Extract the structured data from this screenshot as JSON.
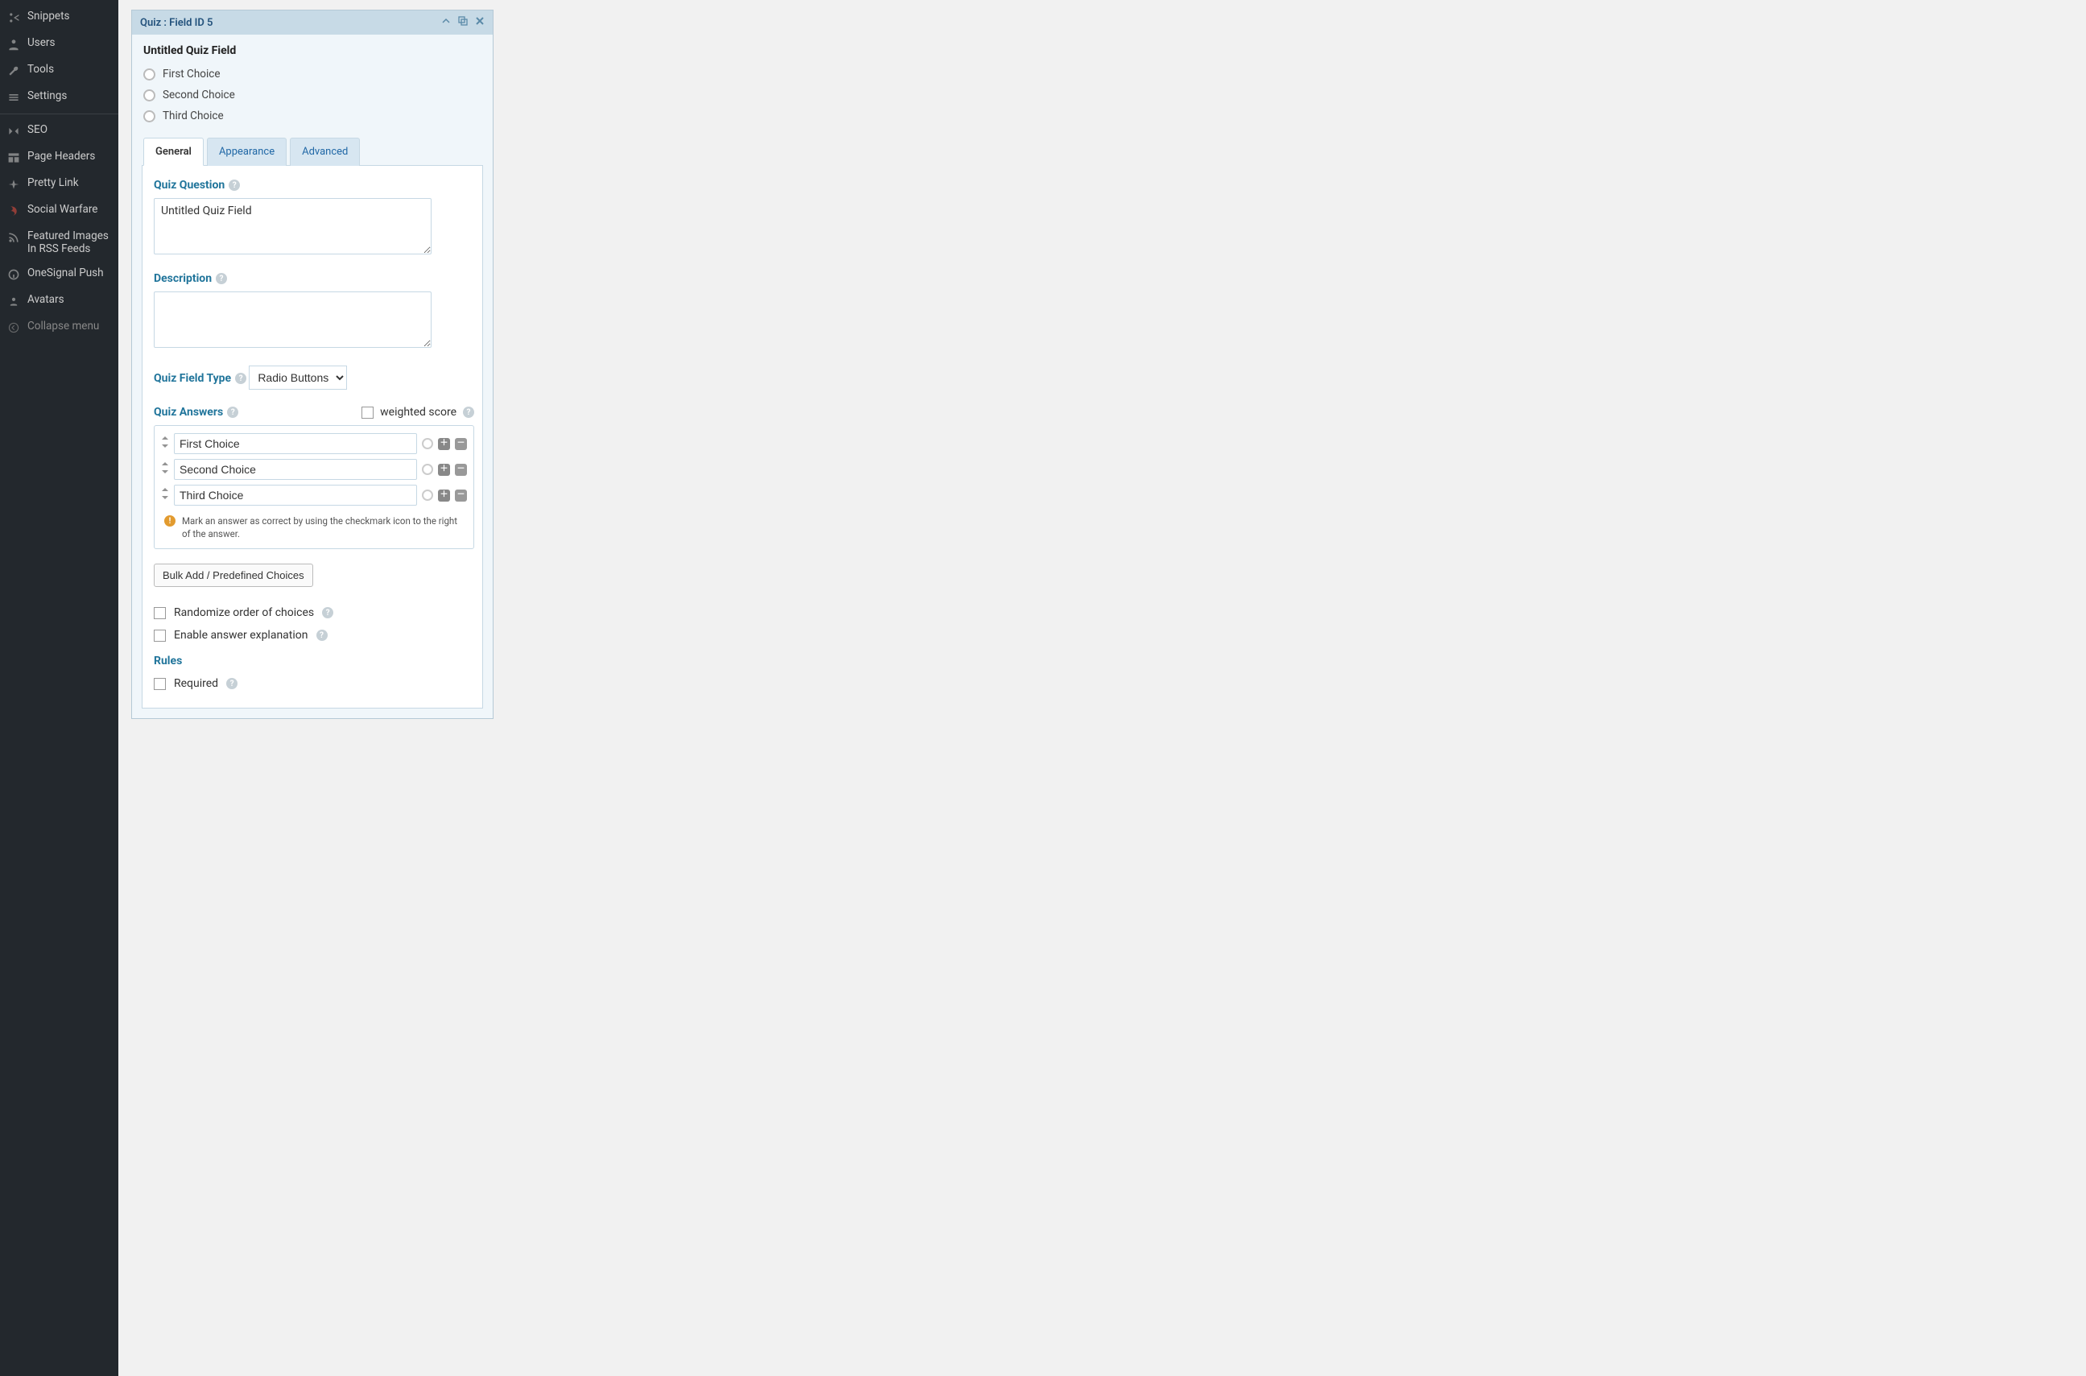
{
  "sidebar": {
    "items": [
      {
        "label": "Snippets"
      },
      {
        "label": "Users"
      },
      {
        "label": "Tools"
      },
      {
        "label": "Settings"
      }
    ],
    "items2": [
      {
        "label": "SEO"
      },
      {
        "label": "Page Headers"
      },
      {
        "label": "Pretty Link"
      },
      {
        "label": "Social Warfare"
      },
      {
        "label": "Featured Images In RSS Feeds"
      },
      {
        "label": "OneSignal Push"
      },
      {
        "label": "Avatars"
      }
    ],
    "collapse": "Collapse menu"
  },
  "panel": {
    "header": "Quiz : Field ID 5",
    "title": "Untitled Quiz Field",
    "choices": [
      "First Choice",
      "Second Choice",
      "Third Choice"
    ]
  },
  "tabs": {
    "general": "General",
    "appearance": "Appearance",
    "advanced": "Advanced"
  },
  "form": {
    "quizQuestionLabel": "Quiz Question",
    "quizQuestionValue": "Untitled Quiz Field",
    "descriptionLabel": "Description",
    "descriptionValue": "",
    "fieldTypeLabel": "Quiz Field Type",
    "fieldTypeValue": "Radio Buttons",
    "answersLabel": "Quiz Answers",
    "weightedLabel": "weighted score",
    "answers": [
      "First Choice",
      "Second Choice",
      "Third Choice"
    ],
    "hint": "Mark an answer as correct by using the checkmark icon to the right of the answer.",
    "bulkAdd": "Bulk Add / Predefined Choices",
    "randomize": "Randomize order of choices",
    "enableExplanation": "Enable answer explanation",
    "rulesLabel": "Rules",
    "requiredLabel": "Required"
  }
}
